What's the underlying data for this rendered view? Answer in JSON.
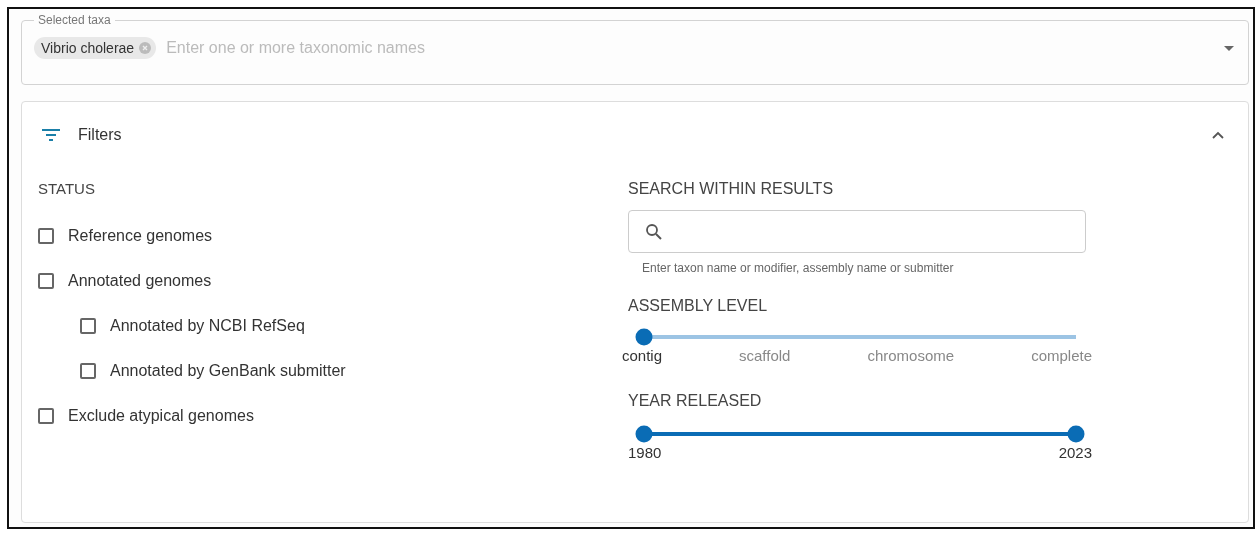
{
  "taxa_field": {
    "legend": "Selected taxa",
    "chips": [
      {
        "label": "Vibrio cholerae"
      }
    ],
    "placeholder": "Enter one or more taxonomic names"
  },
  "filters": {
    "title": "Filters",
    "expanded": true,
    "status": {
      "heading": "STATUS",
      "options": [
        {
          "label": "Reference genomes",
          "checked": false
        },
        {
          "label": "Annotated genomes",
          "checked": false,
          "children": [
            {
              "label": "Annotated by NCBI RefSeq",
              "checked": false
            },
            {
              "label": "Annotated by GenBank submitter",
              "checked": false
            }
          ]
        },
        {
          "label": "Exclude atypical genomes",
          "checked": false
        }
      ]
    },
    "search": {
      "heading": "SEARCH WITHIN RESULTS",
      "helper": "Enter taxon name or modifier, assembly name or submitter"
    },
    "assembly_level": {
      "heading": "ASSEMBLY LEVEL",
      "level": 0,
      "steps": [
        {
          "label": "contig",
          "selected": true
        },
        {
          "label": "scaffold",
          "selected": false
        },
        {
          "label": "chromosome",
          "selected": false
        },
        {
          "label": "complete",
          "selected": false
        }
      ]
    },
    "year_released": {
      "heading": "YEAR RELEASED",
      "level": 1,
      "min_label": "1980",
      "max_label": "2023"
    }
  }
}
